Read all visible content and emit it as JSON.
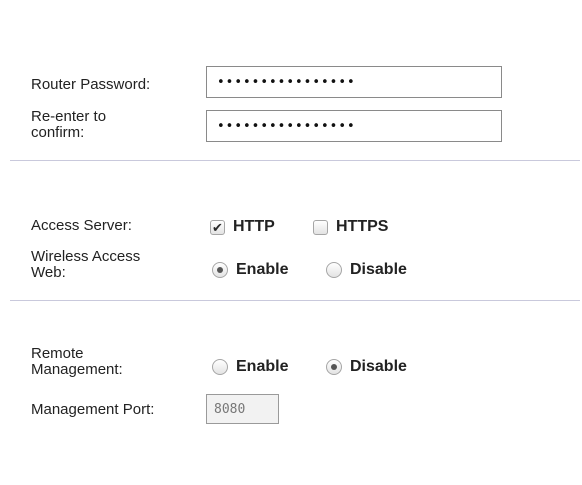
{
  "password_section": {
    "password_label": "Router Password:",
    "password_value": "••••••••••••••••",
    "reenter_label_line1": "Re-enter to",
    "reenter_label_line2": "confirm:",
    "reenter_value": "••••••••••••••••"
  },
  "access_section": {
    "server_label": "Access Server:",
    "http_label": "HTTP",
    "http_checked": true,
    "https_label": "HTTPS",
    "https_checked": false,
    "wireless_label_line1": "Wireless Access",
    "wireless_label_line2": "Web:",
    "enable_label": "Enable",
    "disable_label": "Disable",
    "wireless_selected": "Enable"
  },
  "remote_section": {
    "remote_label_line1": "Remote",
    "remote_label_line2": "Management:",
    "enable_label": "Enable",
    "disable_label": "Disable",
    "remote_selected": "Disable",
    "port_label": "Management Port:",
    "port_value": "8080"
  },
  "icons": {
    "checkmark": "checkmark-icon",
    "radio_dot": "radio-dot-icon"
  },
  "colors": {
    "divider": "#c9c9dc",
    "border": "#8a8a8a",
    "disabled_field": "#f2f2f2"
  }
}
